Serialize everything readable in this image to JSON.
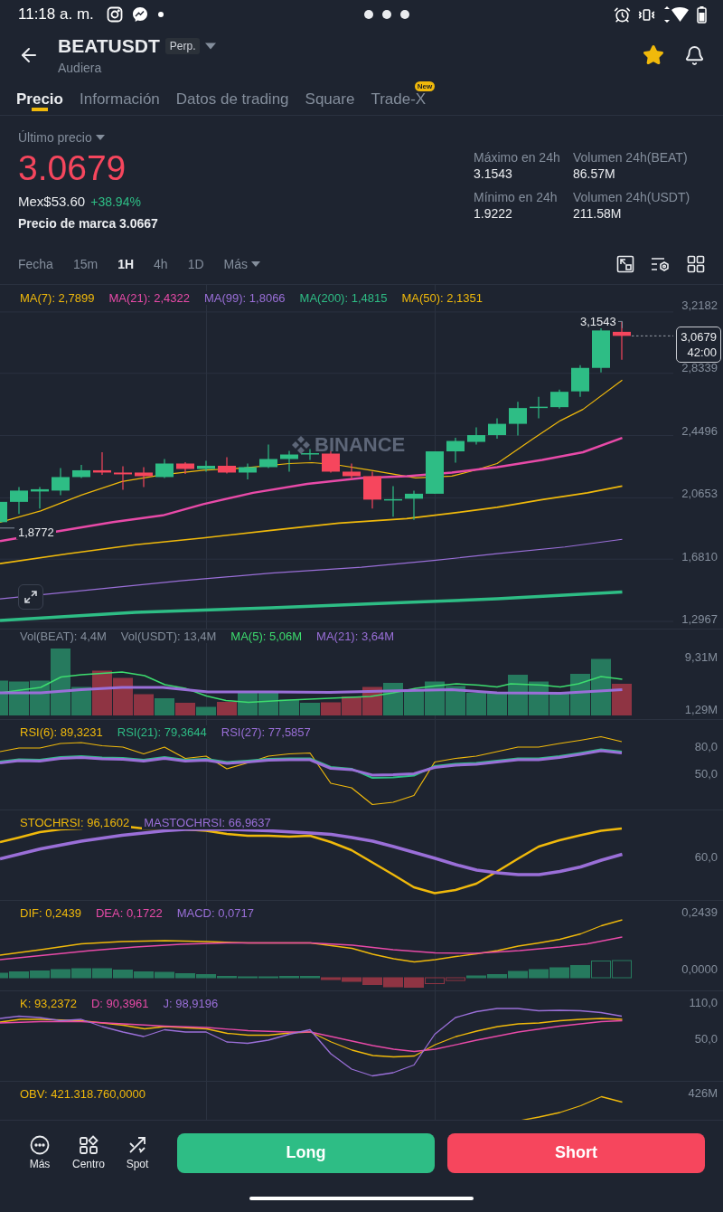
{
  "status_bar": {
    "time": "11:18 a. m."
  },
  "header": {
    "symbol": "BEATUSDT",
    "badge": "Perp.",
    "subtitle": "Audiera",
    "favorite": true
  },
  "tabs": [
    {
      "label": "Precio",
      "selected": true
    },
    {
      "label": "Información",
      "selected": false
    },
    {
      "label": "Datos de trading",
      "selected": false
    },
    {
      "label": "Square",
      "selected": false
    },
    {
      "label": "Trade-X",
      "selected": false,
      "badge": "New"
    }
  ],
  "price": {
    "label": "Último precio",
    "last": "3.0679",
    "fiat": "Mex$53.60",
    "change": "+38.94%",
    "mark": "Precio de marca 3.0667"
  },
  "stats": [
    {
      "label": "Máximo en 24h",
      "value": "3.1543"
    },
    {
      "label": "Volumen 24h(BEAT)",
      "value": "86.57M"
    },
    {
      "label": "Mínimo en 24h",
      "value": "1.9222"
    },
    {
      "label": "Volumen 24h(USDT)",
      "value": "211.58M"
    }
  ],
  "intervals": [
    {
      "label": "Fecha",
      "selected": false,
      "kind": "option"
    },
    {
      "label": "15m",
      "selected": false,
      "kind": "option"
    },
    {
      "label": "1H",
      "selected": true,
      "kind": "option"
    },
    {
      "label": "4h",
      "selected": false,
      "kind": "option"
    },
    {
      "label": "1D",
      "selected": false,
      "kind": "option"
    },
    {
      "label": "Más",
      "selected": false,
      "kind": "menu"
    }
  ],
  "chart": {
    "watermark": "BINANCE",
    "high_label": "3,1543",
    "low_label": "1,8772",
    "last_price": "3,0679",
    "countdown": "42:00",
    "legend": [
      {
        "label": "MA(7): 2,7899",
        "color": "#f0b90b"
      },
      {
        "label": "MA(21): 2,4322",
        "color": "#e84aa8"
      },
      {
        "label": "MA(99): 1,8066",
        "color": "#9a6fd8"
      },
      {
        "label": "MA(200): 1,4815",
        "color": "#2ebd85"
      },
      {
        "label": "MA(50): 2,1351",
        "color": "#f0b90b"
      }
    ],
    "axis": [
      "3,2182",
      "2,8339",
      "2,4496",
      "2,0653",
      "1,6810",
      "1,2967"
    ]
  },
  "panes": [
    {
      "kind": "volume",
      "legend": [
        {
          "label": "Vol(BEAT): 4,4M",
          "color": "#848e9c"
        },
        {
          "label": "Vol(USDT): 13,4M",
          "color": "#848e9c"
        },
        {
          "label": "MA(5): 5,06M",
          "color": "#3ddc6e"
        },
        {
          "label": "MA(21): 3,64M",
          "color": "#9a6fd8"
        }
      ],
      "axis": [
        "9,31M",
        "1,29M"
      ]
    },
    {
      "kind": "rsi",
      "legend": [
        {
          "label": "RSI(6): 89,3231",
          "color": "#f0b90b"
        },
        {
          "label": "RSI(21): 79,3644",
          "color": "#2ebd85"
        },
        {
          "label": "RSI(27): 77,5857",
          "color": "#9a6fd8"
        }
      ],
      "axis": [
        "80,0",
        "50,0"
      ]
    },
    {
      "kind": "stochrsi",
      "legend": [
        {
          "label": "STOCHRSI: 96,1602",
          "color": "#f0b90b"
        },
        {
          "label": "MASTOCHRSI: 66,9637",
          "color": "#9a6fd8"
        }
      ],
      "axis": [
        "60,0"
      ]
    },
    {
      "kind": "macd",
      "legend": [
        {
          "label": "DIF: 0,2439",
          "color": "#f0b90b"
        },
        {
          "label": "DEA: 0,1722",
          "color": "#e84aa8"
        },
        {
          "label": "MACD: 0,0717",
          "color": "#9a6fd8"
        }
      ],
      "axis": [
        "0,2439",
        "0,0000"
      ]
    },
    {
      "kind": "kdj",
      "legend": [
        {
          "label": "K: 93,2372",
          "color": "#f0b90b"
        },
        {
          "label": "D: 90,3961",
          "color": "#e84aa8"
        },
        {
          "label": "J: 98,9196",
          "color": "#9a6fd8"
        }
      ],
      "axis": [
        "110,0",
        "50,0"
      ]
    },
    {
      "kind": "obv",
      "legend": [
        {
          "label": "OBV: 421.318.760,0000",
          "color": "#f0b90b"
        }
      ],
      "axis": [
        "426M"
      ]
    }
  ],
  "actions": [
    {
      "label": "Más",
      "kind": "more"
    },
    {
      "label": "Centro",
      "kind": "hub"
    },
    {
      "label": "Spot",
      "kind": "spot"
    }
  ],
  "buttons": [
    {
      "label": "Long",
      "kind": "long"
    },
    {
      "label": "Short",
      "kind": "short"
    }
  ]
}
